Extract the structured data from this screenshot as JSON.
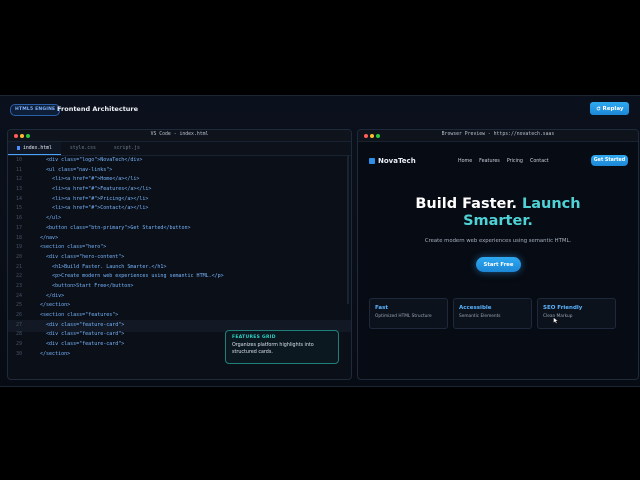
{
  "topbar": {
    "engine_badge": "HTML5 ENGINE",
    "title": "Frontend Architecture",
    "replay_label": "Replay"
  },
  "editor": {
    "window_title": "VS Code - index.html",
    "tabs": [
      "index.html",
      "style.css",
      "script.js"
    ],
    "active_tab": "index.html",
    "lines": [
      {
        "n": "10",
        "t": "    <div class=\"logo\">NovaTech</div>"
      },
      {
        "n": "11",
        "t": "    <ul class=\"nav-links\">"
      },
      {
        "n": "12",
        "t": "      <li><a href=\"#\">Home</a></li>"
      },
      {
        "n": "13",
        "t": "      <li><a href=\"#\">Features</a></li>"
      },
      {
        "n": "14",
        "t": "      <li><a href=\"#\">Pricing</a></li>"
      },
      {
        "n": "15",
        "t": "      <li><a href=\"#\">Contact</a></li>"
      },
      {
        "n": "16",
        "t": "    </ul>"
      },
      {
        "n": "17",
        "t": "    <button class=\"btn-primary\">Get Started</button>"
      },
      {
        "n": "18",
        "t": "  </nav>"
      },
      {
        "n": "19",
        "t": "  <section class=\"hero\">"
      },
      {
        "n": "20",
        "t": "    <div class=\"hero-content\">"
      },
      {
        "n": "21",
        "t": "      <h1>Build Faster. Launch Smarter.</h1>"
      },
      {
        "n": "22",
        "t": "      <p>Create modern web experiences using semantic HTML.</p>"
      },
      {
        "n": "23",
        "t": "      <button>Start Free</button>"
      },
      {
        "n": "24",
        "t": "    </div>"
      },
      {
        "n": "25",
        "t": "  </section>"
      },
      {
        "n": "26",
        "t": "  <section class=\"features\">"
      },
      {
        "n": "27",
        "t": "    <div class=\"feature-card\">"
      },
      {
        "n": "28",
        "t": "    <div class=\"feature-card\">"
      },
      {
        "n": "29",
        "t": "    <div class=\"feature-card\">"
      },
      {
        "n": "30",
        "t": "  </section>"
      }
    ],
    "tooltip": {
      "label": "FEATURES GRID",
      "text": "Organizes platform highlights into structured cards."
    }
  },
  "browser": {
    "window_title": "Browser Preview - https://novatech.saas",
    "logo": "NovaTech",
    "nav": [
      "Home",
      "Features",
      "Pricing",
      "Contact"
    ],
    "get_started": "Get Started",
    "hero_title_white1": "Build Faster.",
    "hero_title_accent1": "Launch",
    "hero_title_accent2": "Smarter.",
    "hero_subtitle": "Create modern web experiences using semantic HTML.",
    "start_free": "Start Free",
    "cards": [
      {
        "title": "Fast",
        "desc": "Optimized HTML Structure"
      },
      {
        "title": "Accessible",
        "desc": "Semantic Elements"
      },
      {
        "title": "SEO Friendly",
        "desc": "Clean Markup"
      }
    ]
  },
  "colors": {
    "accent": "#2ea9f0",
    "teal": "#4fd2d6",
    "dot_red": "#ff5f57",
    "dot_yellow": "#febc2e",
    "dot_green": "#28c840"
  },
  "icons": {
    "replay": "refresh-icon",
    "logo": "logo-square-icon"
  }
}
